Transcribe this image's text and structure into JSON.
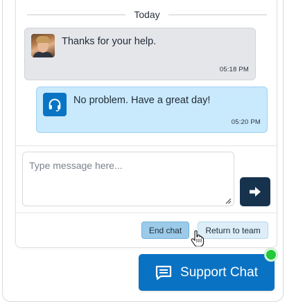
{
  "conversation": {
    "day_label": "Today",
    "messages": [
      {
        "sender": "user",
        "text": "Thanks for your help.",
        "time": "05:18 PM"
      },
      {
        "sender": "agent",
        "text": "No problem. Have a great day!",
        "time": "05:20 PM"
      }
    ]
  },
  "composer": {
    "placeholder": "Type message here...",
    "value": "",
    "send_icon": "arrow-right-icon"
  },
  "actions": {
    "end_chat_label": "End chat",
    "return_to_team_label": "Return to team"
  },
  "launcher": {
    "label": "Support Chat",
    "icon": "chat-bubble-icon",
    "status": "online"
  },
  "colors": {
    "primary": "#0a72c3",
    "send_button": "#17324d",
    "agent_bubble": "#c9e9fc",
    "user_bubble": "#e5e6ea",
    "online": "#22c93a"
  }
}
